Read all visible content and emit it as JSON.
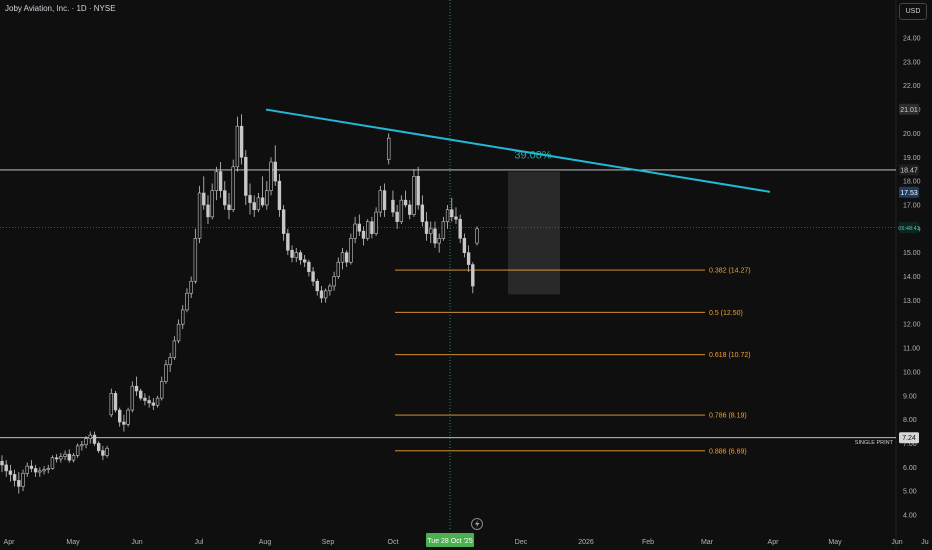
{
  "header": {
    "title": "Joby Aviation, Inc. · 1D · NYSE",
    "currency": "USD"
  },
  "colors": {
    "background": "#0f0f0f",
    "candle": "#c8c8c8",
    "trendline": "#23b8d6",
    "fib": "#f0a32e",
    "measure_text": "#26a69a",
    "date_badge": "#4caf50"
  },
  "chart_data": {
    "type": "candlestick",
    "x_ticks": [
      "Apr",
      "May",
      "Jun",
      "Jul",
      "Aug",
      "Sep",
      "Oct",
      "Dec",
      "2026",
      "Feb",
      "Mar",
      "Apr",
      "May",
      "Jun",
      "Ju"
    ],
    "y_ticks": [
      "4.00",
      "5.00",
      "6.00",
      "7.00",
      "8.00",
      "9.00",
      "10.00",
      "11.00",
      "12.00",
      "13.00",
      "14.00",
      "15.00",
      "16.00",
      "17.00",
      "18.00",
      "19.00",
      "20.00",
      "21.00",
      "22.00",
      "23.00",
      "24.00"
    ],
    "ylim": [
      3.5,
      24.9
    ],
    "price_badges": [
      {
        "label": "21.01",
        "value": 21.01
      },
      {
        "label": "18.47",
        "value": 18.47
      },
      {
        "label": "17.53",
        "value": 17.53
      },
      {
        "label": "05:48:41",
        "value": 16.05
      },
      {
        "label": "7.24",
        "value": 7.24
      }
    ],
    "horizontal_lines": [
      {
        "value": 18.47,
        "label": ""
      },
      {
        "value": 7.24,
        "label": "SINGLE PRINT"
      }
    ],
    "trendline": {
      "start": [
        "Aug 1 '25",
        21.0
      ],
      "end": [
        "Mar 28 '26",
        17.55
      ]
    },
    "measure_box": {
      "label": "39.08%",
      "top": 18.4,
      "bottom": 13.25,
      "start": "Nov 24 '25",
      "end": "Dec 17 '25"
    },
    "crosshair": {
      "date_label": "Tue 28 Oct '25"
    },
    "fib_levels": [
      {
        "label": "0.382 (14.27)",
        "value": 14.27
      },
      {
        "label": "0.5 (12.50)",
        "value": 12.5
      },
      {
        "label": "0.618 (10.72)",
        "value": 10.72
      },
      {
        "label": "0.786 (8.19)",
        "value": 8.19
      },
      {
        "label": "0.886 (6.69)",
        "value": 6.69
      }
    ],
    "candles": [
      {
        "o": 6.25,
        "h": 6.5,
        "l": 5.8,
        "c": 6.1
      },
      {
        "o": 6.1,
        "h": 6.3,
        "l": 5.6,
        "c": 5.85
      },
      {
        "o": 5.85,
        "h": 6.1,
        "l": 5.4,
        "c": 5.7
      },
      {
        "o": 5.7,
        "h": 5.9,
        "l": 5.2,
        "c": 5.45
      },
      {
        "o": 5.45,
        "h": 5.8,
        "l": 4.9,
        "c": 5.2
      },
      {
        "o": 5.2,
        "h": 5.9,
        "l": 5.0,
        "c": 5.75
      },
      {
        "o": 5.75,
        "h": 6.2,
        "l": 5.6,
        "c": 6.05
      },
      {
        "o": 6.05,
        "h": 6.3,
        "l": 5.8,
        "c": 5.95
      },
      {
        "o": 5.95,
        "h": 6.1,
        "l": 5.6,
        "c": 5.8
      },
      {
        "o": 5.8,
        "h": 6.0,
        "l": 5.6,
        "c": 5.85
      },
      {
        "o": 5.85,
        "h": 6.05,
        "l": 5.7,
        "c": 5.9
      },
      {
        "o": 5.9,
        "h": 6.1,
        "l": 5.75,
        "c": 5.95
      },
      {
        "o": 5.95,
        "h": 6.5,
        "l": 5.9,
        "c": 6.4
      },
      {
        "o": 6.4,
        "h": 6.55,
        "l": 6.2,
        "c": 6.35
      },
      {
        "o": 6.35,
        "h": 6.6,
        "l": 6.2,
        "c": 6.45
      },
      {
        "o": 6.45,
        "h": 6.7,
        "l": 6.3,
        "c": 6.55
      },
      {
        "o": 6.55,
        "h": 6.75,
        "l": 6.2,
        "c": 6.3
      },
      {
        "o": 6.3,
        "h": 6.6,
        "l": 6.2,
        "c": 6.5
      },
      {
        "o": 6.5,
        "h": 7.0,
        "l": 6.4,
        "c": 6.9
      },
      {
        "o": 6.9,
        "h": 7.1,
        "l": 6.7,
        "c": 6.95
      },
      {
        "o": 6.95,
        "h": 7.3,
        "l": 6.8,
        "c": 7.2
      },
      {
        "o": 7.2,
        "h": 7.5,
        "l": 7.0,
        "c": 7.35
      },
      {
        "o": 7.35,
        "h": 7.5,
        "l": 6.9,
        "c": 7.0
      },
      {
        "o": 7.0,
        "h": 7.1,
        "l": 6.6,
        "c": 6.7
      },
      {
        "o": 6.7,
        "h": 6.9,
        "l": 6.3,
        "c": 6.5
      },
      {
        "o": 6.5,
        "h": 6.9,
        "l": 6.4,
        "c": 6.8
      },
      {
        "o": 8.2,
        "h": 9.3,
        "l": 8.1,
        "c": 9.1
      },
      {
        "o": 9.1,
        "h": 9.2,
        "l": 8.3,
        "c": 8.4
      },
      {
        "o": 8.4,
        "h": 8.5,
        "l": 7.7,
        "c": 7.9
      },
      {
        "o": 7.9,
        "h": 8.2,
        "l": 7.5,
        "c": 7.8
      },
      {
        "o": 7.8,
        "h": 8.5,
        "l": 7.7,
        "c": 8.4
      },
      {
        "o": 8.4,
        "h": 9.6,
        "l": 8.3,
        "c": 9.4
      },
      {
        "o": 9.4,
        "h": 9.8,
        "l": 9.0,
        "c": 9.2
      },
      {
        "o": 9.2,
        "h": 9.3,
        "l": 8.8,
        "c": 8.9
      },
      {
        "o": 8.9,
        "h": 9.1,
        "l": 8.6,
        "c": 8.8
      },
      {
        "o": 8.8,
        "h": 9.0,
        "l": 8.5,
        "c": 8.7
      },
      {
        "o": 8.7,
        "h": 8.9,
        "l": 8.4,
        "c": 8.6
      },
      {
        "o": 8.6,
        "h": 9.0,
        "l": 8.5,
        "c": 8.9
      },
      {
        "o": 8.9,
        "h": 9.8,
        "l": 8.8,
        "c": 9.6
      },
      {
        "o": 9.6,
        "h": 10.5,
        "l": 9.5,
        "c": 10.3
      },
      {
        "o": 10.3,
        "h": 10.8,
        "l": 10.0,
        "c": 10.6
      },
      {
        "o": 10.6,
        "h": 11.5,
        "l": 10.5,
        "c": 11.3
      },
      {
        "o": 11.3,
        "h": 12.2,
        "l": 11.2,
        "c": 12.0
      },
      {
        "o": 12.0,
        "h": 12.8,
        "l": 11.8,
        "c": 12.6
      },
      {
        "o": 12.6,
        "h": 13.5,
        "l": 12.5,
        "c": 13.3
      },
      {
        "o": 13.3,
        "h": 14.0,
        "l": 13.1,
        "c": 13.8
      },
      {
        "o": 13.8,
        "h": 16.0,
        "l": 13.7,
        "c": 15.6
      },
      {
        "o": 15.6,
        "h": 17.8,
        "l": 15.4,
        "c": 17.5
      },
      {
        "o": 17.5,
        "h": 18.2,
        "l": 16.8,
        "c": 17.0
      },
      {
        "o": 17.0,
        "h": 17.4,
        "l": 16.2,
        "c": 16.5
      },
      {
        "o": 16.5,
        "h": 17.9,
        "l": 16.4,
        "c": 17.6
      },
      {
        "o": 17.6,
        "h": 18.6,
        "l": 17.2,
        "c": 18.4
      },
      {
        "o": 18.4,
        "h": 18.8,
        "l": 17.3,
        "c": 17.6
      },
      {
        "o": 17.6,
        "h": 18.0,
        "l": 16.8,
        "c": 17.0
      },
      {
        "o": 17.0,
        "h": 17.5,
        "l": 16.4,
        "c": 16.8
      },
      {
        "o": 16.8,
        "h": 18.9,
        "l": 16.7,
        "c": 18.6
      },
      {
        "o": 18.6,
        "h": 20.7,
        "l": 18.4,
        "c": 20.3
      },
      {
        "o": 20.3,
        "h": 20.8,
        "l": 18.7,
        "c": 19.0
      },
      {
        "o": 19.0,
        "h": 19.3,
        "l": 17.0,
        "c": 17.4
      },
      {
        "o": 17.4,
        "h": 17.9,
        "l": 16.6,
        "c": 17.1
      },
      {
        "o": 17.1,
        "h": 17.4,
        "l": 16.5,
        "c": 16.8
      },
      {
        "o": 16.8,
        "h": 17.5,
        "l": 16.7,
        "c": 17.3
      },
      {
        "o": 17.3,
        "h": 18.2,
        "l": 16.9,
        "c": 17.0
      },
      {
        "o": 17.0,
        "h": 18.0,
        "l": 16.8,
        "c": 17.6
      },
      {
        "o": 17.6,
        "h": 19.0,
        "l": 17.4,
        "c": 18.8
      },
      {
        "o": 18.8,
        "h": 19.5,
        "l": 17.8,
        "c": 18.0
      },
      {
        "o": 18.0,
        "h": 18.3,
        "l": 16.5,
        "c": 16.8
      },
      {
        "o": 16.8,
        "h": 17.0,
        "l": 15.5,
        "c": 15.8
      },
      {
        "o": 15.8,
        "h": 16.0,
        "l": 14.9,
        "c": 15.1
      },
      {
        "o": 15.1,
        "h": 15.3,
        "l": 14.6,
        "c": 14.8
      },
      {
        "o": 14.8,
        "h": 15.2,
        "l": 14.6,
        "c": 15.0
      },
      {
        "o": 15.0,
        "h": 15.1,
        "l": 14.5,
        "c": 14.7
      },
      {
        "o": 14.7,
        "h": 14.9,
        "l": 14.4,
        "c": 14.6
      },
      {
        "o": 14.6,
        "h": 14.7,
        "l": 14.0,
        "c": 14.2
      },
      {
        "o": 14.2,
        "h": 14.4,
        "l": 13.6,
        "c": 13.8
      },
      {
        "o": 13.8,
        "h": 13.9,
        "l": 13.2,
        "c": 13.4
      },
      {
        "o": 13.4,
        "h": 13.6,
        "l": 12.9,
        "c": 13.1
      },
      {
        "o": 13.1,
        "h": 13.5,
        "l": 12.9,
        "c": 13.4
      },
      {
        "o": 13.4,
        "h": 13.7,
        "l": 13.2,
        "c": 13.6
      },
      {
        "o": 13.6,
        "h": 14.2,
        "l": 13.4,
        "c": 14.0
      },
      {
        "o": 14.0,
        "h": 14.8,
        "l": 13.9,
        "c": 14.6
      },
      {
        "o": 14.6,
        "h": 15.2,
        "l": 14.3,
        "c": 15.0
      },
      {
        "o": 15.0,
        "h": 15.1,
        "l": 14.4,
        "c": 14.6
      },
      {
        "o": 14.6,
        "h": 15.8,
        "l": 14.5,
        "c": 15.6
      },
      {
        "o": 15.6,
        "h": 16.5,
        "l": 15.4,
        "c": 16.2
      },
      {
        "o": 16.2,
        "h": 16.6,
        "l": 15.7,
        "c": 15.9
      },
      {
        "o": 15.9,
        "h": 16.1,
        "l": 15.3,
        "c": 15.6
      },
      {
        "o": 15.6,
        "h": 16.4,
        "l": 15.5,
        "c": 16.3
      },
      {
        "o": 16.3,
        "h": 16.5,
        "l": 15.6,
        "c": 15.8
      },
      {
        "o": 15.8,
        "h": 16.9,
        "l": 15.7,
        "c": 16.7
      },
      {
        "o": 16.7,
        "h": 17.8,
        "l": 16.5,
        "c": 17.6
      },
      {
        "o": 17.6,
        "h": 17.9,
        "l": 16.5,
        "c": 16.8
      },
      {
        "o": 18.9,
        "h": 20.0,
        "l": 18.7,
        "c": 19.8
      },
      {
        "o": 17.2,
        "h": 17.6,
        "l": 16.5,
        "c": 16.7
      },
      {
        "o": 16.7,
        "h": 17.0,
        "l": 16.0,
        "c": 16.3
      },
      {
        "o": 16.3,
        "h": 17.4,
        "l": 16.2,
        "c": 17.2
      },
      {
        "o": 17.2,
        "h": 17.6,
        "l": 16.9,
        "c": 17.0
      },
      {
        "o": 17.0,
        "h": 17.2,
        "l": 16.4,
        "c": 16.6
      },
      {
        "o": 16.6,
        "h": 18.5,
        "l": 16.5,
        "c": 18.2
      },
      {
        "o": 18.2,
        "h": 18.6,
        "l": 16.8,
        "c": 17.0
      },
      {
        "o": 17.0,
        "h": 17.4,
        "l": 16.1,
        "c": 16.3
      },
      {
        "o": 16.3,
        "h": 16.7,
        "l": 15.5,
        "c": 15.8
      },
      {
        "o": 15.8,
        "h": 16.3,
        "l": 15.4,
        "c": 16.0
      },
      {
        "o": 16.0,
        "h": 16.3,
        "l": 15.2,
        "c": 15.4
      },
      {
        "o": 15.4,
        "h": 15.8,
        "l": 15.0,
        "c": 15.6
      },
      {
        "o": 15.6,
        "h": 16.5,
        "l": 15.5,
        "c": 16.3
      },
      {
        "o": 16.3,
        "h": 17.0,
        "l": 16.0,
        "c": 16.8
      },
      {
        "o": 16.8,
        "h": 17.3,
        "l": 16.3,
        "c": 16.5
      },
      {
        "o": 16.5,
        "h": 16.9,
        "l": 16.2,
        "c": 16.4
      },
      {
        "o": 16.4,
        "h": 16.6,
        "l": 15.4,
        "c": 15.6
      },
      {
        "o": 15.6,
        "h": 15.8,
        "l": 14.8,
        "c": 15.0
      },
      {
        "o": 15.0,
        "h": 15.3,
        "l": 14.2,
        "c": 14.5
      },
      {
        "o": 14.5,
        "h": 14.6,
        "l": 13.3,
        "c": 13.6
      },
      {
        "o": 15.4,
        "h": 16.1,
        "l": 15.3,
        "c": 16.0
      }
    ]
  }
}
